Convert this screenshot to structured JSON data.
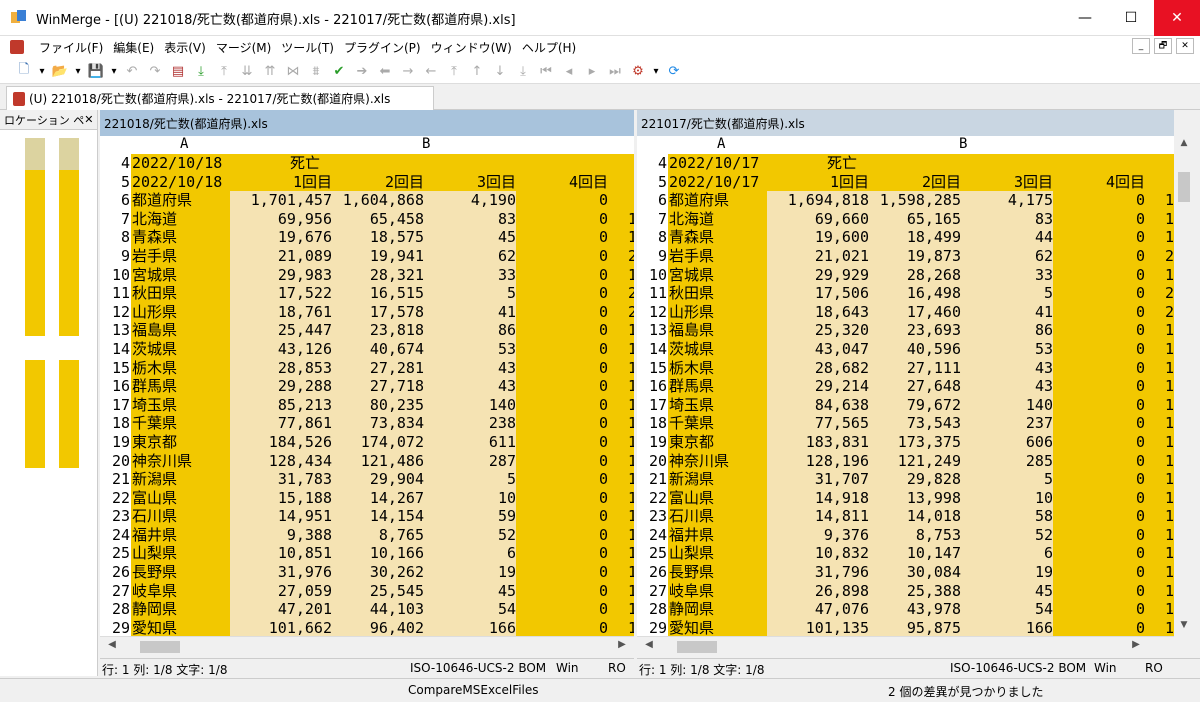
{
  "window": {
    "title": "WinMerge - [(U) 221018/死亡数(都道府県).xls - 221017/死亡数(都道府県).xls]",
    "minimize_glyph": "—",
    "maximize_glyph": "☐",
    "close_glyph": "✕"
  },
  "menu": {
    "items": [
      "ファイル(F)",
      "編集(E)",
      "表示(V)",
      "マージ(M)",
      "ツール(T)",
      "プラグイン(P)",
      "ウィンドウ(W)",
      "ヘルプ(H)"
    ],
    "mdi_minimize": "_",
    "mdi_restore": "🗗",
    "mdi_close": "✕"
  },
  "toolbar": {
    "icons": [
      "new-icon",
      "dropdown-icon",
      "open-folder-icon",
      "dropdown-icon",
      "save-icon",
      "dropdown-icon",
      "undo-icon",
      "redo-icon",
      "filmstrip-icon",
      "copy-down-icon",
      "copy-up-icon",
      "copy-all-down-icon",
      "copy-all-up-icon",
      "merge-icon",
      "merge-all-icon",
      "merge-green-icon",
      "arrow-right-icon",
      "arrow-left-icon",
      "arrow-right-dim-icon",
      "arrow-left-dim-icon",
      "first-diff-icon",
      "prev-diff-icon",
      "next-diff-icon",
      "last-diff-icon",
      "goto-first-icon",
      "goto-prev-icon",
      "goto-next-icon",
      "goto-last-icon",
      "options-icon",
      "dropdown-icon",
      "refresh-icon"
    ]
  },
  "tab": {
    "label": "(U) 221018/死亡数(都道府県).xls - 221017/死亡数(都道府県).xls"
  },
  "location_pane": {
    "title": "ロケーション ペ",
    "close": "✕",
    "colors": {
      "diff": "#f2c800",
      "same": "#ffffff",
      "selected": "#c8c8e8"
    }
  },
  "columns": {
    "a": "A",
    "b": "B"
  },
  "left": {
    "header": "221018/死亡数(都道府県).xls",
    "date": "2022/10/18",
    "rows": [
      [
        "4",
        "2022/10/18",
        "死亡",
        "",
        "",
        "",
        ""
      ],
      [
        "5",
        "2022/10/18",
        "1回目",
        "2回目",
        "3回目",
        "4回目",
        ""
      ],
      [
        "6",
        "都道府県",
        "1,701,457",
        "1,604,868",
        "4,190",
        "0",
        ""
      ],
      [
        "7",
        "北海道",
        "69,956",
        "65,458",
        "83",
        "0",
        "1"
      ],
      [
        "8",
        "青森県",
        "19,676",
        "18,575",
        "45",
        "0",
        "1"
      ],
      [
        "9",
        "岩手県",
        "21,089",
        "19,941",
        "62",
        "0",
        "2"
      ],
      [
        "10",
        "宮城県",
        "29,983",
        "28,321",
        "33",
        "0",
        "1"
      ],
      [
        "11",
        "秋田県",
        "17,522",
        "16,515",
        "5",
        "0",
        "2"
      ],
      [
        "12",
        "山形県",
        "18,761",
        "17,578",
        "41",
        "0",
        "2"
      ],
      [
        "13",
        "福島県",
        "25,447",
        "23,818",
        "86",
        "0",
        "1"
      ],
      [
        "14",
        "茨城県",
        "43,126",
        "40,674",
        "53",
        "0",
        "1"
      ],
      [
        "15",
        "栃木県",
        "28,853",
        "27,281",
        "43",
        "0",
        "1"
      ],
      [
        "16",
        "群馬県",
        "29,288",
        "27,718",
        "43",
        "0",
        "1"
      ],
      [
        "17",
        "埼玉県",
        "85,213",
        "80,235",
        "140",
        "0",
        "1"
      ],
      [
        "18",
        "千葉県",
        "77,861",
        "73,834",
        "238",
        "0",
        "1"
      ],
      [
        "19",
        "東京都",
        "184,526",
        "174,072",
        "611",
        "0",
        "1"
      ],
      [
        "20",
        "神奈川県",
        "128,434",
        "121,486",
        "287",
        "0",
        "1"
      ],
      [
        "21",
        "新潟県",
        "31,783",
        "29,904",
        "5",
        "0",
        "1"
      ],
      [
        "22",
        "富山県",
        "15,188",
        "14,267",
        "10",
        "0",
        "1"
      ],
      [
        "23",
        "石川県",
        "14,951",
        "14,154",
        "59",
        "0",
        "1"
      ],
      [
        "24",
        "福井県",
        "9,388",
        "8,765",
        "52",
        "0",
        "1"
      ],
      [
        "25",
        "山梨県",
        "10,851",
        "10,166",
        "6",
        "0",
        "1"
      ],
      [
        "26",
        "長野県",
        "31,976",
        "30,262",
        "19",
        "0",
        "1"
      ],
      [
        "27",
        "岐阜県",
        "27,059",
        "25,545",
        "45",
        "0",
        "1"
      ],
      [
        "28",
        "静岡県",
        "47,201",
        "44,103",
        "54",
        "0",
        "1"
      ],
      [
        "29",
        "愛知県",
        "101,662",
        "96,402",
        "166",
        "0",
        "1"
      ]
    ],
    "status": {
      "pos": "行: 1  列: 1/8  文字: 1/8",
      "encoding": "ISO-10646-UCS-2 BOM",
      "eol": "Win",
      "ro": "RO"
    }
  },
  "right": {
    "header": "221017/死亡数(都道府県).xls",
    "rows": [
      [
        "4",
        "2022/10/17",
        "死亡",
        "",
        "",
        "",
        ""
      ],
      [
        "5",
        "2022/10/17",
        "1回目",
        "2回目",
        "3回目",
        "4回目",
        ""
      ],
      [
        "6",
        "都道府県",
        "1,694,818",
        "1,598,285",
        "4,175",
        "0",
        "1"
      ],
      [
        "7",
        "北海道",
        "69,660",
        "65,165",
        "83",
        "0",
        "1"
      ],
      [
        "8",
        "青森県",
        "19,600",
        "18,499",
        "44",
        "0",
        "1"
      ],
      [
        "9",
        "岩手県",
        "21,021",
        "19,873",
        "62",
        "0",
        "2"
      ],
      [
        "10",
        "宮城県",
        "29,929",
        "28,268",
        "33",
        "0",
        "1"
      ],
      [
        "11",
        "秋田県",
        "17,506",
        "16,498",
        "5",
        "0",
        "2"
      ],
      [
        "12",
        "山形県",
        "18,643",
        "17,460",
        "41",
        "0",
        "2"
      ],
      [
        "13",
        "福島県",
        "25,320",
        "23,693",
        "86",
        "0",
        "1"
      ],
      [
        "14",
        "茨城県",
        "43,047",
        "40,596",
        "53",
        "0",
        "1"
      ],
      [
        "15",
        "栃木県",
        "28,682",
        "27,111",
        "43",
        "0",
        "1"
      ],
      [
        "16",
        "群馬県",
        "29,214",
        "27,648",
        "43",
        "0",
        "1"
      ],
      [
        "17",
        "埼玉県",
        "84,638",
        "79,672",
        "140",
        "0",
        "1"
      ],
      [
        "18",
        "千葉県",
        "77,565",
        "73,543",
        "237",
        "0",
        "1"
      ],
      [
        "19",
        "東京都",
        "183,831",
        "173,375",
        "606",
        "0",
        "1"
      ],
      [
        "20",
        "神奈川県",
        "128,196",
        "121,249",
        "285",
        "0",
        "1"
      ],
      [
        "21",
        "新潟県",
        "31,707",
        "29,828",
        "5",
        "0",
        "1"
      ],
      [
        "22",
        "富山県",
        "14,918",
        "13,998",
        "10",
        "0",
        "1"
      ],
      [
        "23",
        "石川県",
        "14,811",
        "14,018",
        "58",
        "0",
        "1"
      ],
      [
        "24",
        "福井県",
        "9,376",
        "8,753",
        "52",
        "0",
        "1"
      ],
      [
        "25",
        "山梨県",
        "10,832",
        "10,147",
        "6",
        "0",
        "1"
      ],
      [
        "26",
        "長野県",
        "31,796",
        "30,084",
        "19",
        "0",
        "1"
      ],
      [
        "27",
        "岐阜県",
        "26,898",
        "25,388",
        "45",
        "0",
        "1"
      ],
      [
        "28",
        "静岡県",
        "47,076",
        "43,978",
        "54",
        "0",
        "1"
      ],
      [
        "29",
        "愛知県",
        "101,135",
        "95,875",
        "166",
        "0",
        "1"
      ]
    ],
    "status": {
      "pos": "行: 1  列: 1/8  文字: 1/8",
      "encoding": "ISO-10646-UCS-2 BOM",
      "eol": "Win",
      "ro": "RO"
    }
  },
  "statusbar": {
    "plugin": "CompareMSExcelFiles",
    "message": "2 個の差異が見つかりました"
  }
}
